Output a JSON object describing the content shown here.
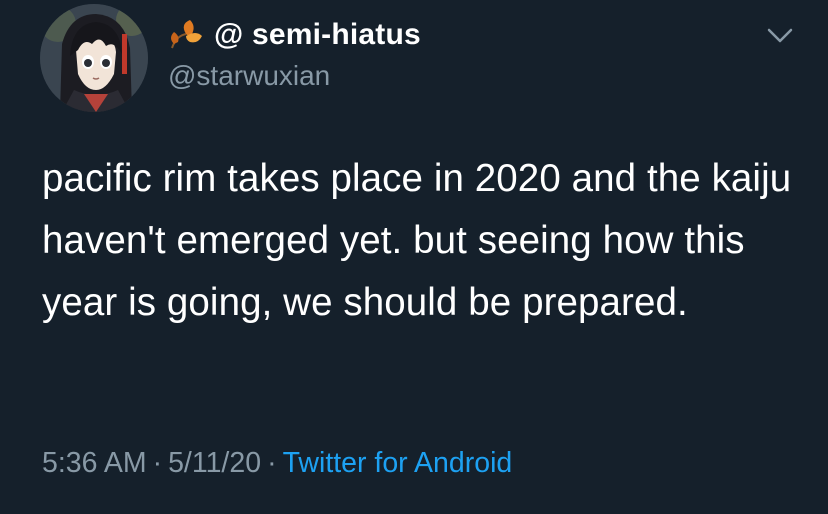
{
  "author": {
    "display_name": "@ semi-hiatus",
    "handle": "@starwuxian",
    "name_icon": "autumn-leaf-icon",
    "avatar_icon": "anime-avatar"
  },
  "tweet": {
    "text": "pacific rim takes place in 2020 and the kaiju haven't emerged yet. but seeing how this year is going, we should be prepared."
  },
  "meta": {
    "time": "5:36 AM",
    "date": "5/11/20",
    "separator": "·",
    "source": "Twitter for Android"
  },
  "controls": {
    "menu_icon": "chevron-down-icon"
  },
  "colors": {
    "background": "#15202b",
    "primary_text": "#ffffff",
    "secondary_text": "#8899a6",
    "link": "#1da1f2"
  }
}
